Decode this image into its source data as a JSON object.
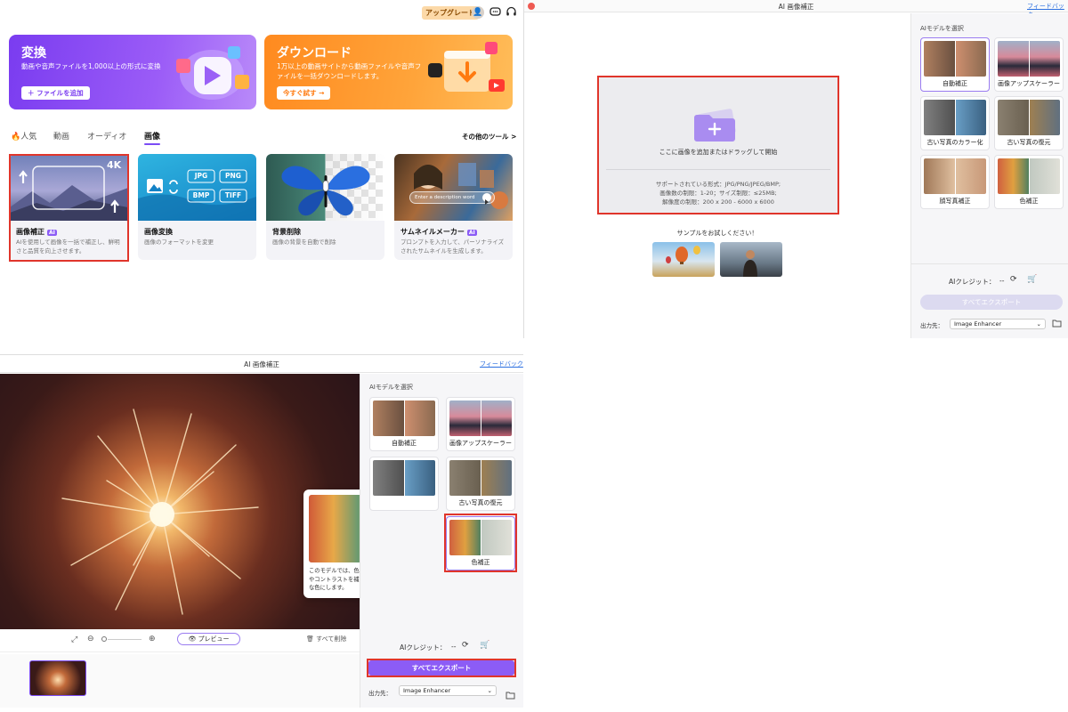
{
  "home": {
    "upgrade_label": "アップグレード",
    "banners": [
      {
        "title": "変換",
        "desc": "動画や音声ファイルを1,000以上の形式に変換",
        "button": "ファイルを追加"
      },
      {
        "title": "ダウンロード",
        "desc": "1万以上の動画サイトから動画ファイルや音声ファイルを一括ダウンロードします。",
        "button": "今すぐ試す"
      }
    ],
    "tabs": [
      "🔥人気",
      "動画",
      "オーディオ",
      "画像"
    ],
    "more_tools": "その他のツール >",
    "cards": [
      {
        "title": "画像補正",
        "ai": "AI",
        "desc": "AIを使用して画像を一括で補正し、鮮明さと品質を向上させます。",
        "badge": "4K"
      },
      {
        "title": "画像変換",
        "ai": "",
        "desc": "画像のフォーマットを変更",
        "formats": [
          "JPG",
          "PNG",
          "BMP",
          "TIFF"
        ]
      },
      {
        "title": "背景削除",
        "ai": "",
        "desc": "画像の背景を自動で削除"
      },
      {
        "title": "サムネイルメーカー",
        "ai": "AI",
        "desc": "プロンプトを入力して、パーソナライズされたサムネイルを生成します。",
        "prompt": "Enter a description word"
      }
    ]
  },
  "enhancer": {
    "title": "AI 画像補正",
    "feedback": "フィードバック",
    "models_header": "AIモデルを選択",
    "models": [
      "自動補正",
      "画像アップスケーラー",
      "古い写真のカラー化",
      "古い写真の復元",
      "顔写真補正",
      "色補正"
    ],
    "drop_text": "ここに画像を追加またはドラッグして開始",
    "supported_formats": "サポートされている形式：JPG/PNG/JPEG/BMP;",
    "count_limit": "画像数の制限：1-20；サイズ制限：≤25MB;",
    "resolution_limit": "解像度の制限：200 x 200 - 6000 x 6000",
    "samples_label": "サンプルをお試しください！",
    "credit_label": "AIクレジット：",
    "credit_value": "--",
    "export_all": "すべてエクスポート",
    "output_label": "出力先：",
    "output_value": "Image Enhancer"
  },
  "preview_panel": {
    "preview_button": "プレビュー",
    "delete_all": "すべて削除",
    "tooltip": "このモデルでは、色被りを削除し、画像の明るさやコントラストを補正して、よりリアルで鮮やかな色にします。"
  }
}
